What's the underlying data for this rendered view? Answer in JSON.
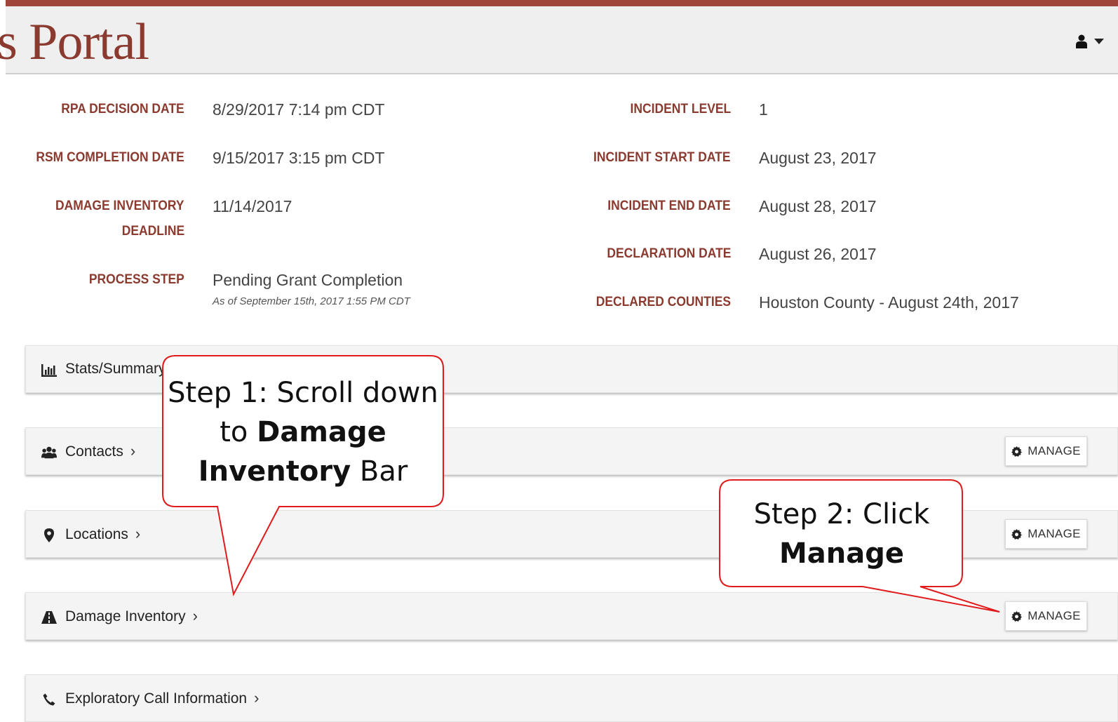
{
  "header": {
    "logo_text": "s Portal",
    "user_icon": "user-icon",
    "menu_caret_icon": "caret-down-icon",
    "accent_color": "#8b3a2f",
    "topline_color": "#a0453a"
  },
  "details_left": [
    {
      "label": "RPA DECISION DATE",
      "value": "8/29/2017 7:14 pm CDT"
    },
    {
      "label": "RSM COMPLETION DATE",
      "value": "9/15/2017 3:15 pm CDT"
    },
    {
      "label_line1": "DAMAGE INVENTORY",
      "label_line2": "DEADLINE",
      "value": "11/14/2017"
    },
    {
      "label": "PROCESS STEP",
      "value": "Pending Grant Completion",
      "sub": "As of September 15th, 2017 1:55 PM CDT"
    }
  ],
  "details_right": [
    {
      "label": "INCIDENT LEVEL",
      "value": "1"
    },
    {
      "label": "INCIDENT START DATE",
      "value": "August 23, 2017"
    },
    {
      "label": "INCIDENT END DATE",
      "value": "August 28, 2017"
    },
    {
      "label": "DECLARATION DATE",
      "value": "August 26, 2017"
    },
    {
      "label": "DECLARED COUNTIES",
      "value": "Houston County - August 24th, 2017"
    }
  ],
  "sections": [
    {
      "label": "Stats/Summary",
      "icon": "bar-chart-icon",
      "chevron": ""
    },
    {
      "label": "Contacts",
      "icon": "users-icon",
      "chevron": "›",
      "manage": "MANAGE"
    },
    {
      "label": "Locations",
      "icon": "map-marker-icon",
      "chevron": "›",
      "manage": "MANAGE"
    },
    {
      "label": "Damage Inventory",
      "icon": "road-icon",
      "chevron": "›",
      "manage": "MANAGE"
    },
    {
      "label": "Exploratory Call Information",
      "icon": "phone-icon",
      "chevron": "›"
    }
  ],
  "callouts": {
    "step1": {
      "prefix": "Step 1: Scroll down to ",
      "bold1": "Damage Inventory",
      "suffix": " Bar"
    },
    "step2": {
      "prefix": "Step 2: Click",
      "bold1": "Manage"
    },
    "border_color": "#e01b1b"
  }
}
